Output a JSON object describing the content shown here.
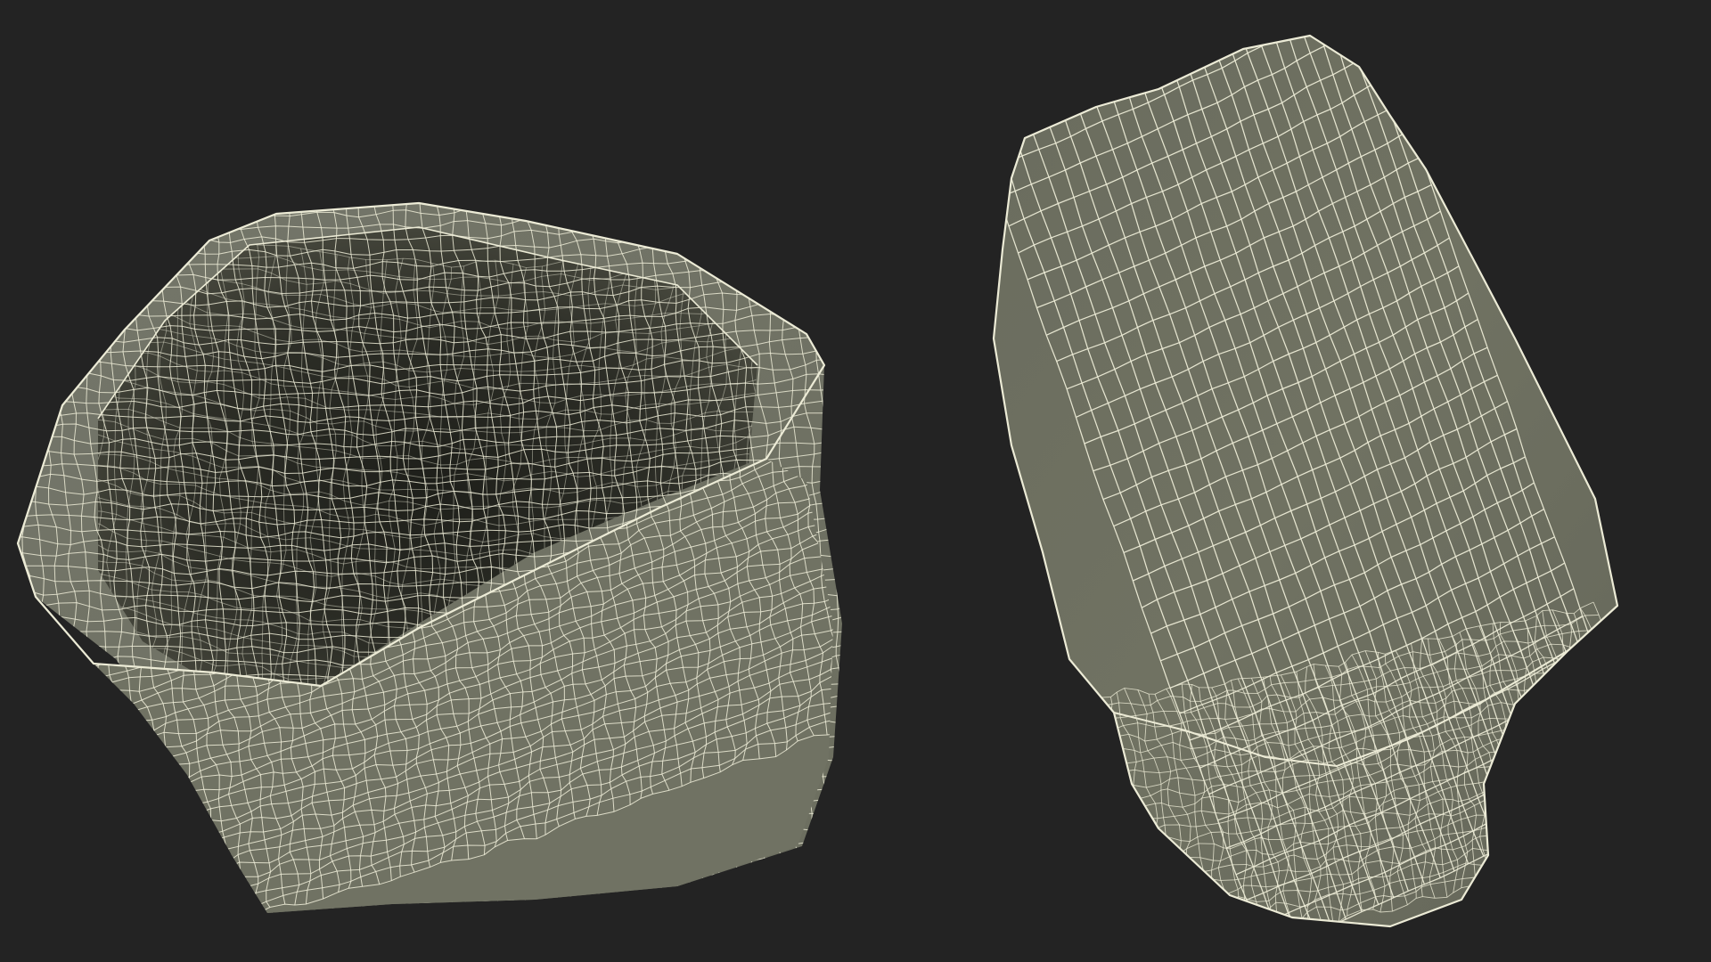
{
  "scene": {
    "background_color": "#232323",
    "mesh_fill_color": "#6f715f",
    "mesh_inner_color": "#3a3b32",
    "mesh_inner_shadow_color": "#1e1f1a",
    "wire_color": "#ecebd6",
    "objects": [
      {
        "name": "open-crumpled-sack",
        "description_icon": "open-bag-wireframe"
      },
      {
        "name": "closed-crumpled-sack",
        "description_icon": "closed-bag-wireframe"
      }
    ]
  }
}
